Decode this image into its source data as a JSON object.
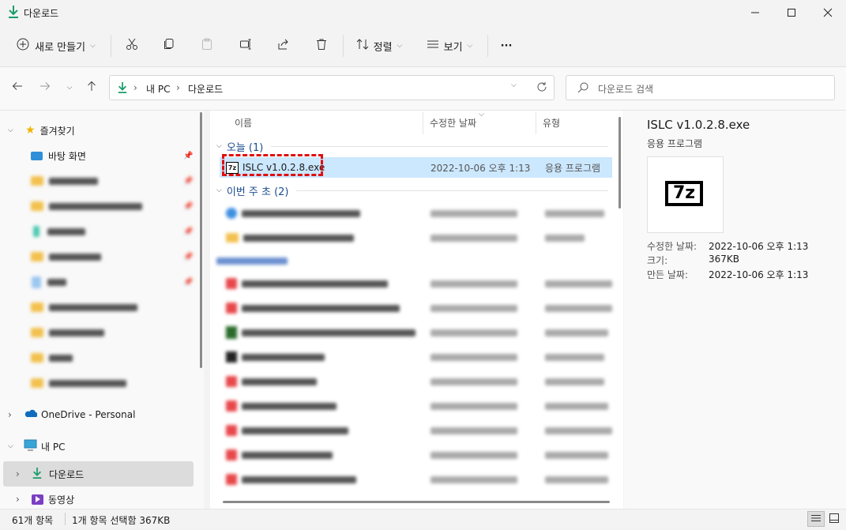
{
  "window": {
    "title": "다운로드",
    "controls": [
      "minimize-icon",
      "maximize-icon",
      "close-icon"
    ]
  },
  "toolbar": {
    "new_label": "새로 만들기",
    "sort_label": "정렬",
    "view_label": "보기",
    "more_label": "···"
  },
  "address": {
    "path": [
      "내 PC",
      "다운로드"
    ]
  },
  "search": {
    "placeholder": "다운로드 검색"
  },
  "nav": {
    "quick_access": "즐겨찾기",
    "desktop": "바탕 화면",
    "onedrive": "OneDrive - Personal",
    "this_pc": "내 PC",
    "downloads": "다운로드",
    "videos": "동영상"
  },
  "files": {
    "col_name": "이름",
    "col_modified": "수정한 날짜",
    "col_type": "유형",
    "group_today": "오늘 (1)",
    "group_week": "이번 주 초 (2)",
    "selected_file": {
      "name": "ISLC v1.0.2.8.exe",
      "modified": "2022-10-06 오후 1:13",
      "type": "응용 프로그램"
    }
  },
  "details": {
    "title": "ISLC v1.0.2.8.exe",
    "subtitle": "응용 프로그램",
    "props": [
      {
        "label": "수정한 날짜:",
        "value": "2022-10-06 오후 1:13"
      },
      {
        "label": "크기:",
        "value": "367KB"
      },
      {
        "label": "만든 날짜:",
        "value": "2022-10-06 오후 1:13"
      }
    ]
  },
  "status": {
    "items_count": "61개 항목",
    "selection": "1개 항목 선택함 367KB"
  },
  "colors": {
    "accent": "#0067c0",
    "selection_bg": "#cce8ff",
    "highlight_box": "#e01010",
    "download_green": "#1a9c6b"
  }
}
